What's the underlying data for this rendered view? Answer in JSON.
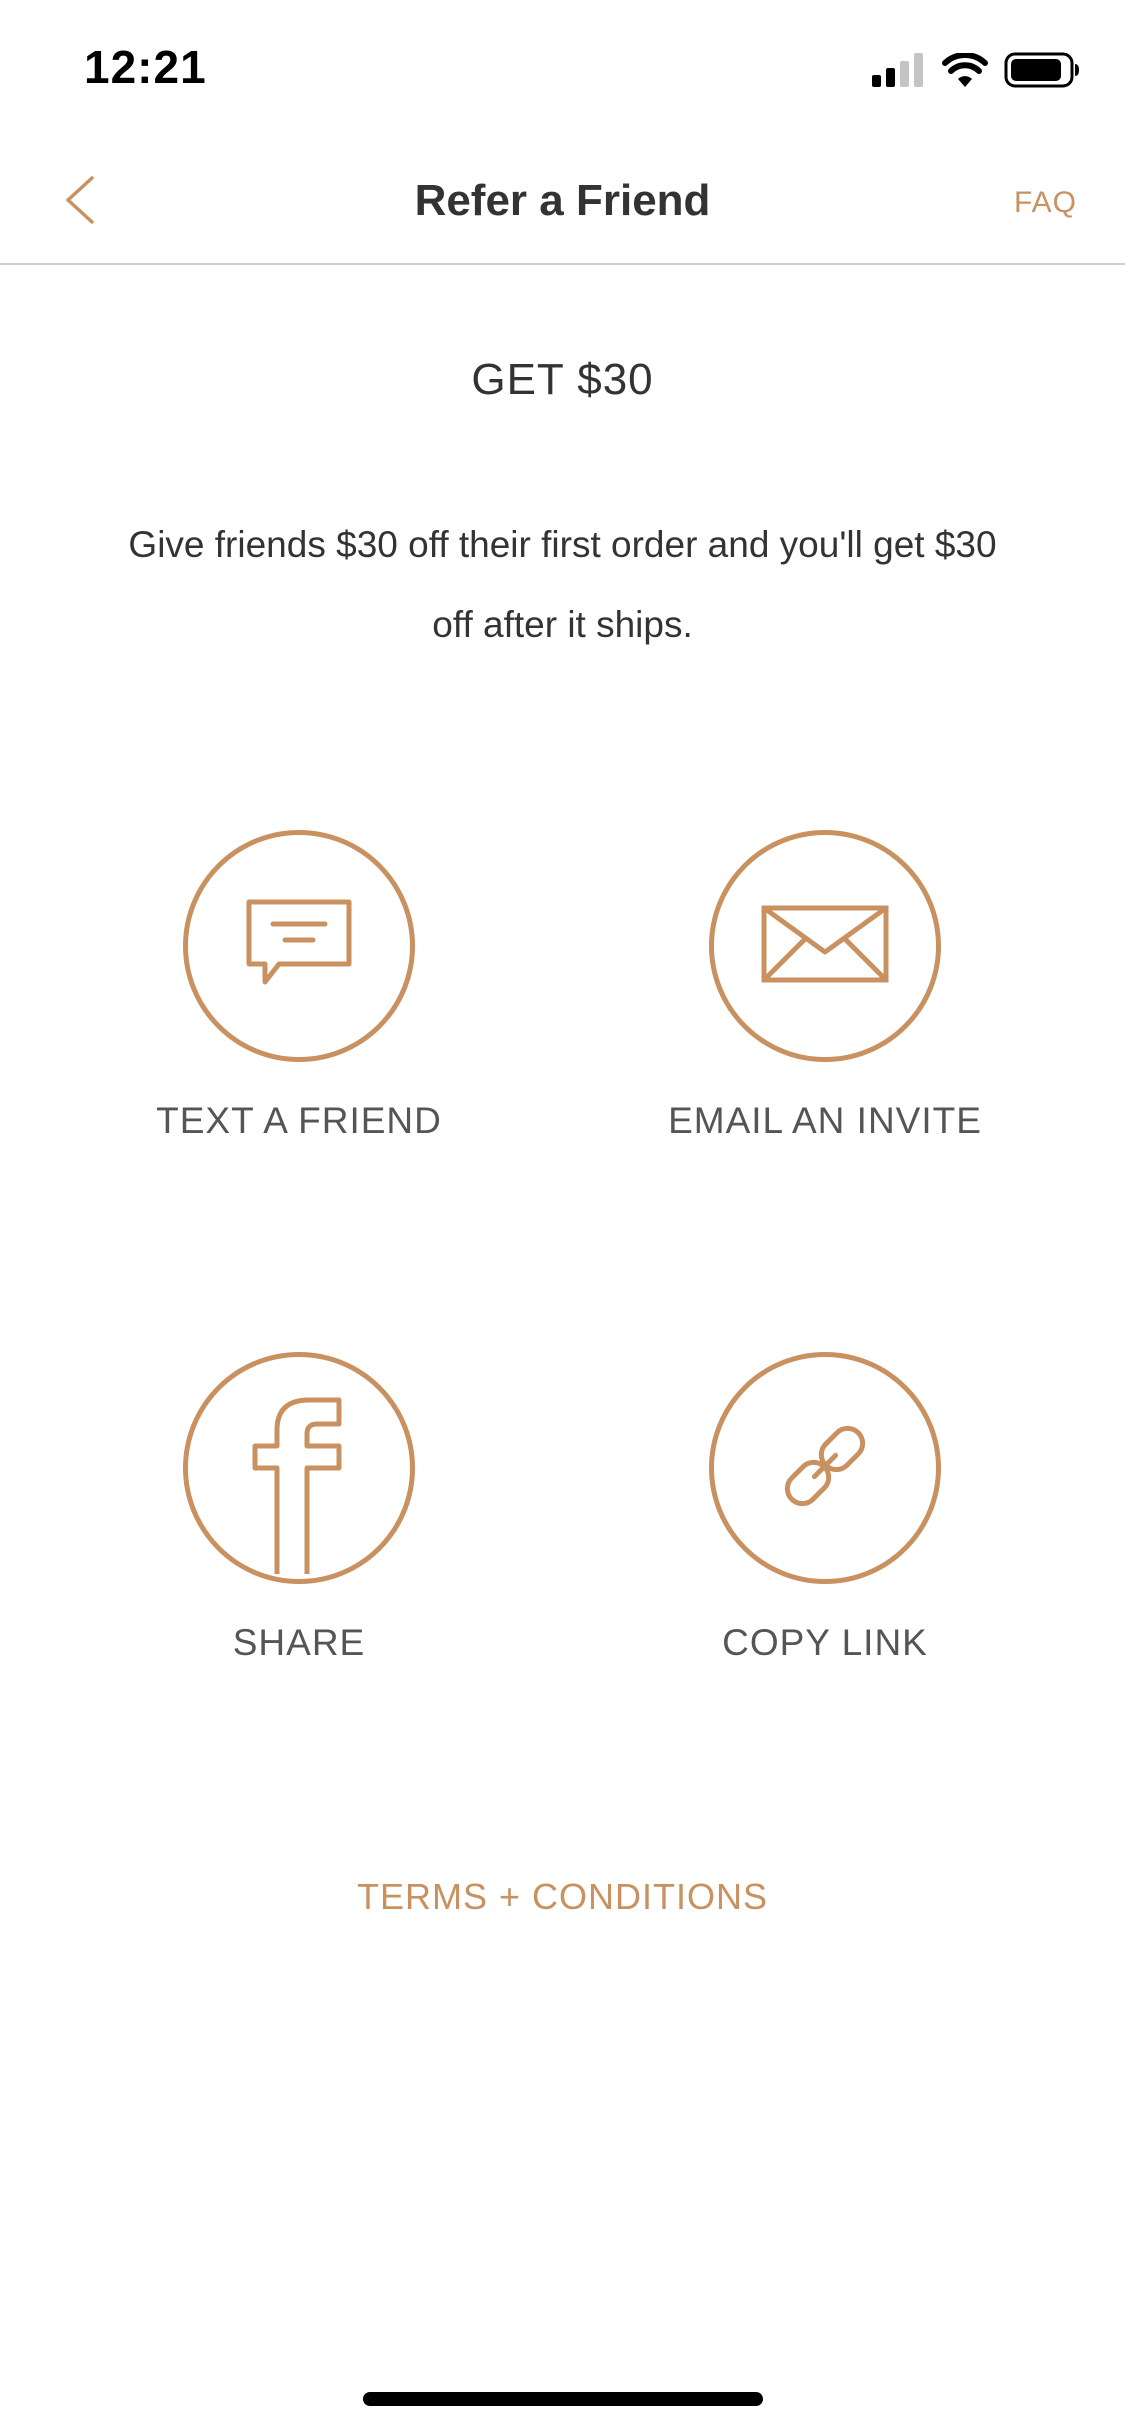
{
  "status_bar": {
    "time": "12:21",
    "icons": [
      "cellular-signal-icon",
      "wifi-icon",
      "battery-icon"
    ]
  },
  "nav": {
    "back_icon": "chevron-left-icon",
    "title": "Refer a Friend",
    "faq_label": "FAQ"
  },
  "offer": {
    "headline": "GET $30",
    "description": "Give friends $30 off their first order and you'll get $30 off after it ships."
  },
  "actions": [
    {
      "icon": "chat-bubble-icon",
      "label": "TEXT A FRIEND"
    },
    {
      "icon": "envelope-icon",
      "label": "EMAIL AN INVITE"
    },
    {
      "icon": "facebook-icon",
      "label": "SHARE"
    },
    {
      "icon": "link-icon",
      "label": "COPY LINK"
    }
  ],
  "terms_label": "TERMS + CONDITIONS",
  "colors": {
    "accent": "#c8915f",
    "text_dark": "#333333",
    "text_label": "#555555",
    "divider": "#cfcfcf",
    "background": "#ffffff"
  }
}
